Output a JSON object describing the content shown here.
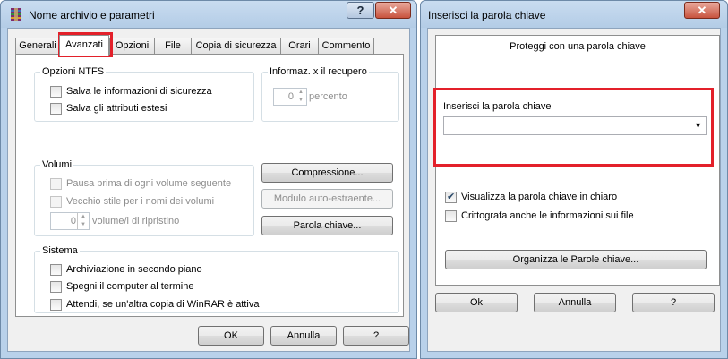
{
  "archive_window": {
    "title": "Nome archivio e parametri",
    "help_btn": "?",
    "close_btn": "✕",
    "tabs": [
      {
        "label": "Generali"
      },
      {
        "label": "Avanzati"
      },
      {
        "label": "Opzioni"
      },
      {
        "label": "File"
      },
      {
        "label": "Copia di sicurezza"
      },
      {
        "label": "Orari"
      },
      {
        "label": "Commento"
      }
    ],
    "ntfs": {
      "label": "Opzioni NTFS",
      "items": [
        {
          "label": "Salva le informazioni di sicurezza",
          "checked": false
        },
        {
          "label": "Salva gli attributi estesi",
          "checked": false
        }
      ]
    },
    "recovery": {
      "label": "Informaz. x il recupero",
      "value": "0",
      "unit": "percento"
    },
    "volumes": {
      "label": "Volumi",
      "items": [
        {
          "label": "Pausa prima di ogni volume seguente",
          "checked": false
        },
        {
          "label": "Vecchio stile per i nomi dei volumi",
          "checked": false
        }
      ],
      "recovery_value": "0",
      "recovery_unit": "volume/i di ripristino"
    },
    "buttons": {
      "compression": "Compressione...",
      "sfx": "Modulo auto-estraente...",
      "password": "Parola chiave..."
    },
    "system": {
      "label": "Sistema",
      "items": [
        {
          "label": "Archiviazione in secondo piano",
          "checked": false
        },
        {
          "label": "Spegni il computer al termine",
          "checked": false
        },
        {
          "label": "Attendi, se un'altra copia di WinRAR è attiva",
          "checked": false
        }
      ]
    },
    "footer": {
      "ok": "OK",
      "cancel": "Annulla",
      "help": "?"
    }
  },
  "password_window": {
    "title": "Inserisci la parola chiave",
    "close_btn": "✕",
    "header": "Proteggi con una parola chiave",
    "field_label": "Inserisci la parola chiave",
    "field_value": "",
    "show_password": {
      "label": "Visualizza la parola chiave in chiaro",
      "checked": true
    },
    "encrypt_names": {
      "label": "Crittografa anche le informazioni sui file",
      "checked": false
    },
    "organize_btn": "Organizza le Parole chiave...",
    "footer": {
      "ok": "Ok",
      "cancel": "Annulla",
      "help": "?"
    }
  },
  "colors": {
    "highlight": "#e3202a",
    "window_frame": "#b9d1ea"
  }
}
